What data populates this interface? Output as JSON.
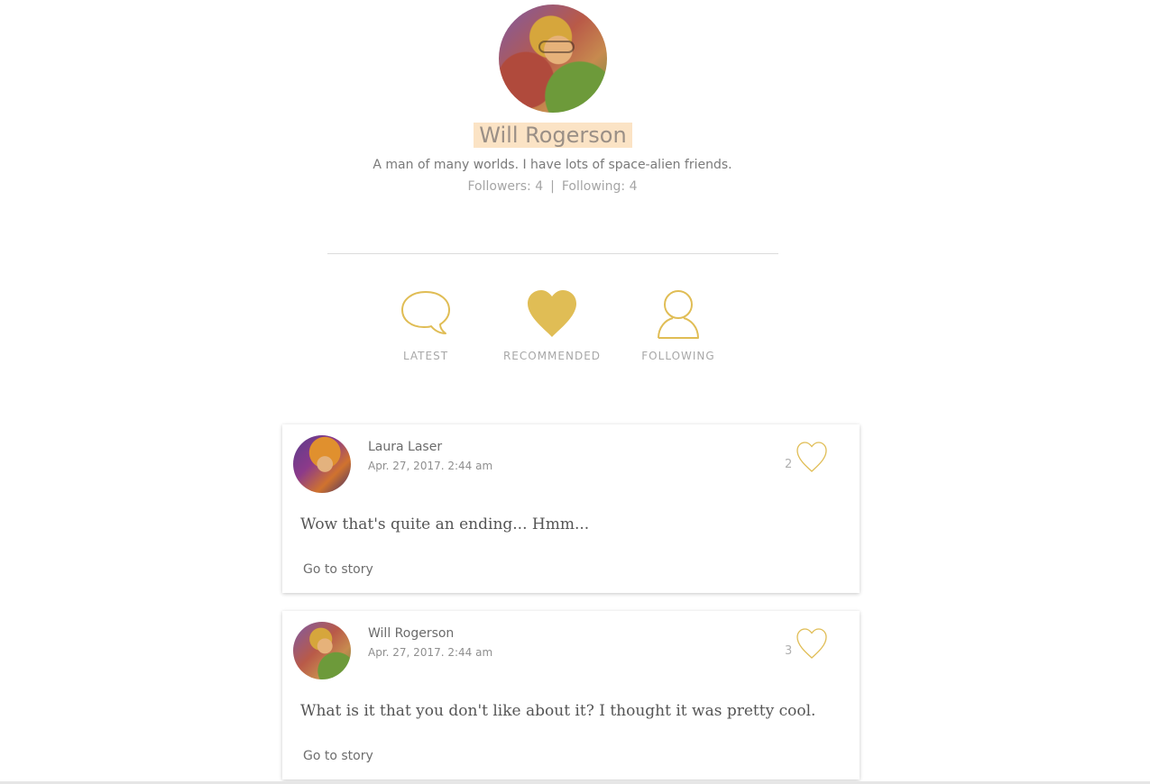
{
  "profile": {
    "name": "Will Rogerson",
    "bio": "A man of many worlds. I have lots of space-alien friends.",
    "followers": "Followers: 4",
    "separator": "|",
    "following": "Following: 4"
  },
  "tabs": [
    {
      "label": "LATEST",
      "icon": "speech-bubble-icon"
    },
    {
      "label": "RECOMMENDED",
      "icon": "heart-icon"
    },
    {
      "label": "FOLLOWING",
      "icon": "person-icon"
    }
  ],
  "cards": [
    {
      "author": "Laura Laser",
      "date": "Apr. 27, 2017. 2:44 am",
      "likes": "2",
      "text": "Wow that's quite an ending... Hmm...",
      "link": "Go to story"
    },
    {
      "author": "Will Rogerson",
      "date": "Apr. 27, 2017. 2:44 am",
      "likes": "3",
      "text": "What is it that you don't like about it? I thought it was pretty cool.",
      "link": "Go to story"
    }
  ],
  "colors": {
    "accent": "#e0bd55",
    "name_highlight": "#fbe3c5"
  }
}
